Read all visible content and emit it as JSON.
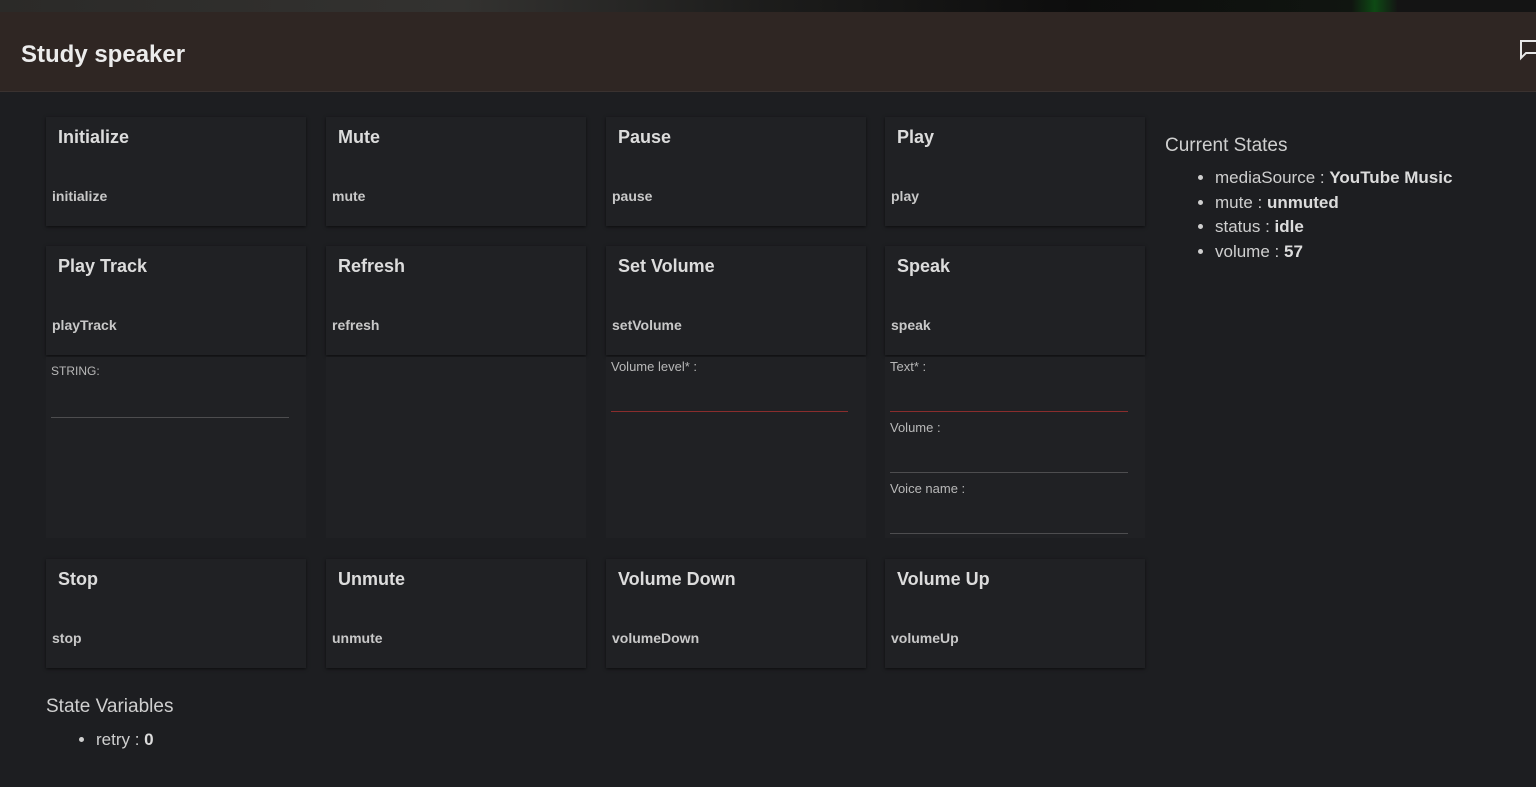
{
  "header": {
    "title": "Study speaker",
    "chat_icon": "chat-icon"
  },
  "commands": [
    {
      "title": "Initialize",
      "name": "initialize"
    },
    {
      "title": "Mute",
      "name": "mute"
    },
    {
      "title": "Pause",
      "name": "pause"
    },
    {
      "title": "Play",
      "name": "play"
    },
    {
      "title": "Play Track",
      "name": "playTrack"
    },
    {
      "title": "Refresh",
      "name": "refresh"
    },
    {
      "title": "Set Volume",
      "name": "setVolume"
    },
    {
      "title": "Speak",
      "name": "speak"
    },
    {
      "title": "Stop",
      "name": "stop"
    },
    {
      "title": "Unmute",
      "name": "unmute"
    },
    {
      "title": "Volume Down",
      "name": "volumeDown"
    },
    {
      "title": "Volume Up",
      "name": "volumeUp"
    }
  ],
  "params": {
    "playTrack": [
      {
        "label": "STRING:",
        "value": ""
      }
    ],
    "setVolume": [
      {
        "label": "Volume level* :",
        "value": ""
      }
    ],
    "speak": [
      {
        "label": "Text* :",
        "value": ""
      },
      {
        "label": "Volume :",
        "value": ""
      },
      {
        "label": "Voice name :",
        "value": ""
      }
    ]
  },
  "current_states": {
    "title": "Current States",
    "items": [
      {
        "key": "mediaSource",
        "sep": " : ",
        "value": "YouTube Music"
      },
      {
        "key": "mute",
        "sep": " : ",
        "value": "unmuted"
      },
      {
        "key": "status",
        "sep": " : ",
        "value": "idle"
      },
      {
        "key": "volume",
        "sep": " : ",
        "value": "57"
      }
    ]
  },
  "state_variables": {
    "title": "State Variables",
    "items": [
      {
        "key": "retry",
        "sep": " : ",
        "value": "0"
      }
    ]
  },
  "colors": {
    "background": "#1d1e21",
    "header": "#2f2623",
    "card": "#202124",
    "required_underline": "#8a2d2d"
  }
}
